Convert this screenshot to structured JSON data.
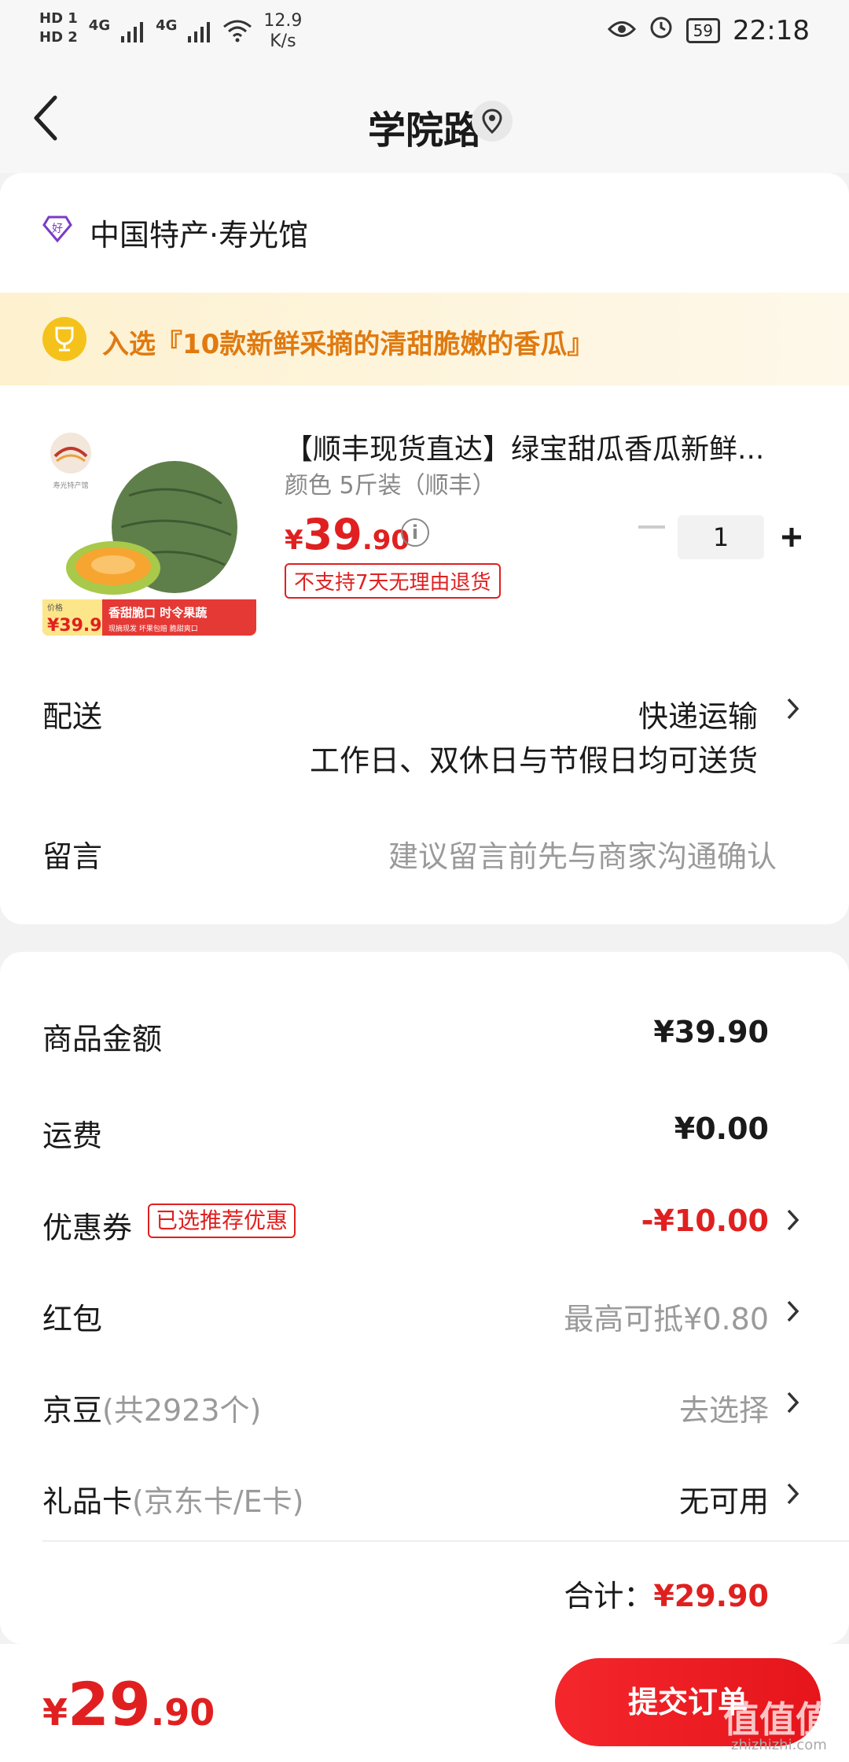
{
  "status_bar": {
    "hd1": "HD 1",
    "hd2": "HD 2",
    "net1": "4G",
    "net2": "4G",
    "speed": "12.9",
    "speed_unit": "K/s",
    "battery": "59",
    "time": "22:18"
  },
  "header": {
    "title": "学院路"
  },
  "shop": {
    "name": "中国特产·寿光馆"
  },
  "banner": {
    "text": "入选『10款新鲜采摘的清甜脆嫩的香瓜』"
  },
  "product": {
    "name": "【顺丰现货直达】绿宝甜瓜香瓜新鲜...",
    "spec": "颜色 5斤装（顺丰）",
    "price_symbol": "¥",
    "price_int": "39",
    "price_dec": ".90",
    "return_tag": "不支持7天无理由退货",
    "quantity": "1",
    "image_price_label": "价格",
    "image_price": "¥39.9",
    "image_slogan": "香甜脆口 时令果蔬",
    "image_subslogan": "现摘现发 坏果包赔 脆甜爽口"
  },
  "delivery": {
    "label": "配送",
    "method": "快递运输",
    "note": "工作日、双休日与节假日均可送货"
  },
  "message": {
    "label": "留言",
    "placeholder": "建议留言前先与商家沟通确认"
  },
  "summary": {
    "goods_label": "商品金额",
    "goods_value": "¥39.90",
    "shipping_label": "运费",
    "shipping_value": "¥0.00",
    "coupon_label": "优惠券",
    "coupon_tag": "已选推荐优惠",
    "coupon_value": "-¥10.00",
    "redpacket_label": "红包",
    "redpacket_value": "最高可抵¥0.80",
    "jdbean_label": "京豆",
    "jdbean_count": "(共2923个)",
    "jdbean_value": "去选择",
    "giftcard_label": "礼品卡",
    "giftcard_sub": "(京东卡/E卡)",
    "giftcard_value": "无可用",
    "total_label": "合计：",
    "total_value": "¥29.90"
  },
  "bottom_bar": {
    "price_symbol": "¥",
    "price_int": "29",
    "price_dec": ".90",
    "submit_label": "提交订单",
    "watermark": "值值值",
    "watermark_site": "zhizhizhi.com"
  },
  "colors": {
    "accent_red": "#e02020",
    "banner_orange": "#e07a10"
  }
}
